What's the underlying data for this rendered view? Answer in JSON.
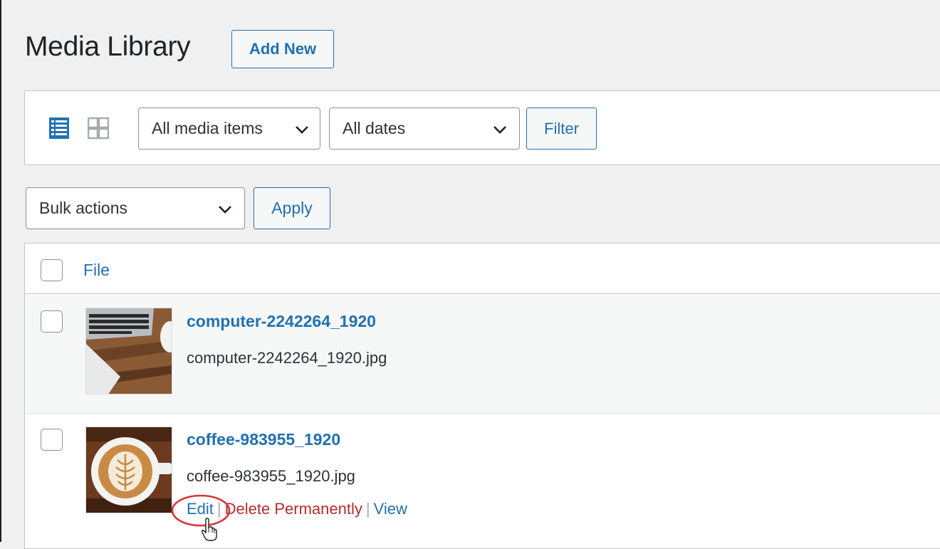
{
  "page": {
    "title": "Media Library",
    "add_new_label": "Add New"
  },
  "toolbar": {
    "view_modes": [
      {
        "name": "list-view-icon",
        "active": true
      },
      {
        "name": "grid-view-icon",
        "active": false
      }
    ],
    "media_type_select": {
      "value": "All media items"
    },
    "date_select": {
      "value": "All dates"
    },
    "filter_label": "Filter"
  },
  "bulk": {
    "select_value": "Bulk actions",
    "apply_label": "Apply"
  },
  "table": {
    "columns": [
      {
        "label": "File"
      }
    ],
    "rows": [
      {
        "title": "computer-2242264_1920",
        "filename": "computer-2242264_1920.jpg",
        "thumbnail": "laptop-photo"
      },
      {
        "title": "coffee-983955_1920",
        "filename": "coffee-983955_1920.jpg",
        "thumbnail": "coffee-latte-photo",
        "row_actions": {
          "edit": "Edit",
          "delete": "Delete Permanently",
          "view": "View"
        }
      }
    ]
  },
  "colors": {
    "accent": "#2271b1",
    "danger": "#b32d2e",
    "highlight_ring": "#d63638",
    "background": "#f0f0f1"
  }
}
